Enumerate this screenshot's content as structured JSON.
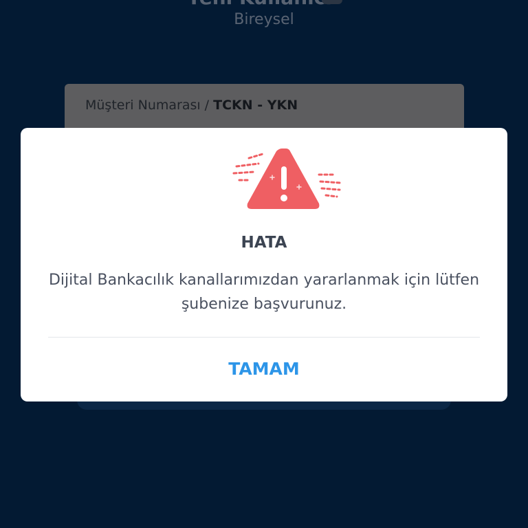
{
  "background": {
    "title": "Yeni Kullanıcı",
    "subtitle": "Bireysel",
    "field_label_prefix": "Müşteri Numarası / ",
    "field_label_strong": "TCKN - YKN"
  },
  "dialog": {
    "icon": "warning-triangle-icon",
    "title": "HATA",
    "message": "Dijital Bankacılık kanallarımızdan yararlanmak için lütfen şubenize başvurunuz.",
    "button_label": "TAMAM"
  },
  "colors": {
    "screen_background": "#031a33",
    "dialog_background": "#ffffff",
    "warning_red": "#ef5f63",
    "button_blue": "#2d95e8",
    "text_dark": "#3c4452"
  }
}
